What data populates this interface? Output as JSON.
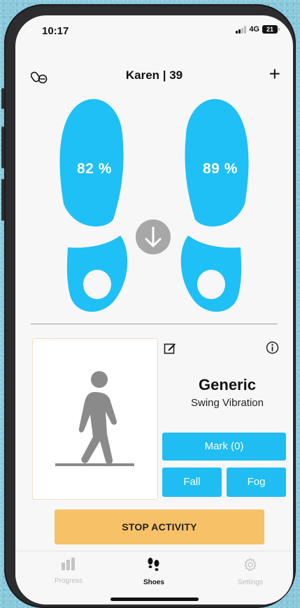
{
  "status_bar": {
    "time": "10:17",
    "network": "4G",
    "battery": "21"
  },
  "header": {
    "title": "Karen | 39",
    "add_icon": "plus-icon",
    "left_icon": "insole-link-icon"
  },
  "feet": {
    "left_percent": "82 %",
    "right_percent": "89 %",
    "center_icon": "arrow-down-icon",
    "foot_color": "#1fc0f5"
  },
  "activity": {
    "icon": "walking-person-icon",
    "edit_icon": "edit-icon",
    "info_icon": "info-icon"
  },
  "profile": {
    "name": "Generic",
    "subtitle": "Swing Vibration"
  },
  "buttons": {
    "mark": "Mark (0)",
    "fall": "Fall",
    "fog": "Fog",
    "stop": "STOP ACTIVITY"
  },
  "tabs": [
    {
      "label": "Progress",
      "icon": "bar-chart-icon",
      "active": false
    },
    {
      "label": "Shoes",
      "icon": "footprints-icon",
      "active": true
    },
    {
      "label": "Settings",
      "icon": "gear-icon",
      "active": false
    }
  ],
  "colors": {
    "accent": "#1fbdf2",
    "stop": "#f7c167"
  }
}
